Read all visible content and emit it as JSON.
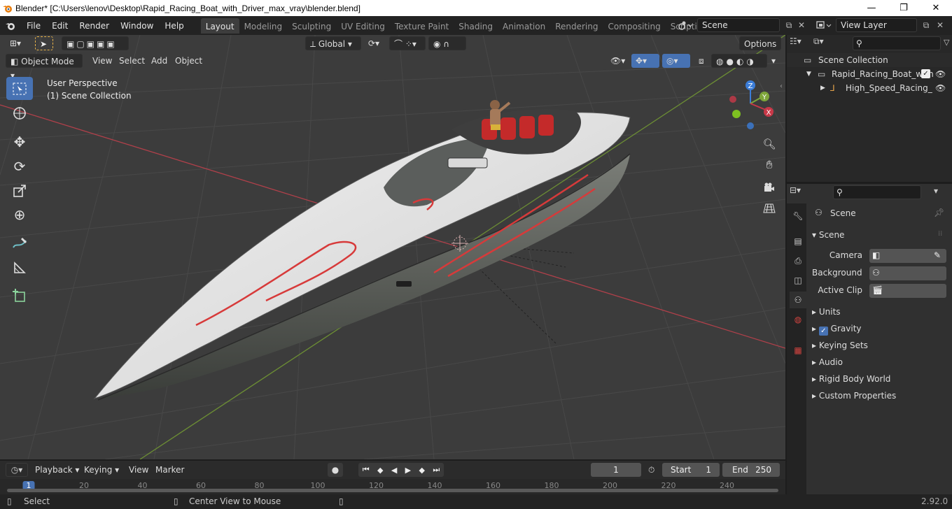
{
  "window": {
    "title": "Blender* [C:\\Users\\lenov\\Desktop\\Rapid_Racing_Boat_with_Driver_max_vray\\blender.blend]"
  },
  "menus": [
    "File",
    "Edit",
    "Render",
    "Window",
    "Help"
  ],
  "workspaces": [
    {
      "label": "Layout",
      "active": true
    },
    {
      "label": "Modeling"
    },
    {
      "label": "Sculpting"
    },
    {
      "label": "UV Editing"
    },
    {
      "label": "Texture Paint"
    },
    {
      "label": "Shading"
    },
    {
      "label": "Animation"
    },
    {
      "label": "Rendering"
    },
    {
      "label": "Compositing"
    },
    {
      "label": "Scripting"
    }
  ],
  "scene_field": "Scene",
  "view_layer_field": "View Layer",
  "viewport": {
    "orientation": "Global",
    "options_label": "Options",
    "mode": "Object Mode",
    "header_menus": [
      "View",
      "Select",
      "Add",
      "Object"
    ],
    "overlay_line1": "User Perspective",
    "overlay_line2": "(1) Scene Collection",
    "axis_labels": {
      "z": "Z",
      "y": "Y",
      "x": "X"
    }
  },
  "outliner": {
    "root": "Scene Collection",
    "items": [
      {
        "label": "Rapid_Racing_Boat_with",
        "checked": true
      },
      {
        "label": "High_Speed_Racing_"
      }
    ]
  },
  "properties": {
    "header": "Scene",
    "section": "Scene",
    "fields": [
      {
        "label": "Camera"
      },
      {
        "label": "Background ..."
      },
      {
        "label": "Active Clip"
      }
    ],
    "subsections": [
      "Units",
      "Gravity",
      "Keying Sets",
      "Audio",
      "Rigid Body World",
      "Custom Properties"
    ],
    "gravity_checked": true
  },
  "timeline": {
    "menus": [
      "Playback",
      "Keying",
      "View",
      "Marker"
    ],
    "current_frame": "1",
    "start_label": "Start",
    "start": "1",
    "end_label": "End",
    "end": "250",
    "ticks": [
      "1",
      "20",
      "40",
      "60",
      "80",
      "100",
      "120",
      "140",
      "160",
      "180",
      "200",
      "220",
      "240"
    ]
  },
  "statusbar": {
    "left": "Select",
    "middle": "Center View to Mouse",
    "version": "2.92.0"
  },
  "colors": {
    "accent": "#4772b3",
    "x_axis": "#c83848",
    "y_axis": "#7ea63a",
    "z_axis": "#3b7dd8"
  }
}
